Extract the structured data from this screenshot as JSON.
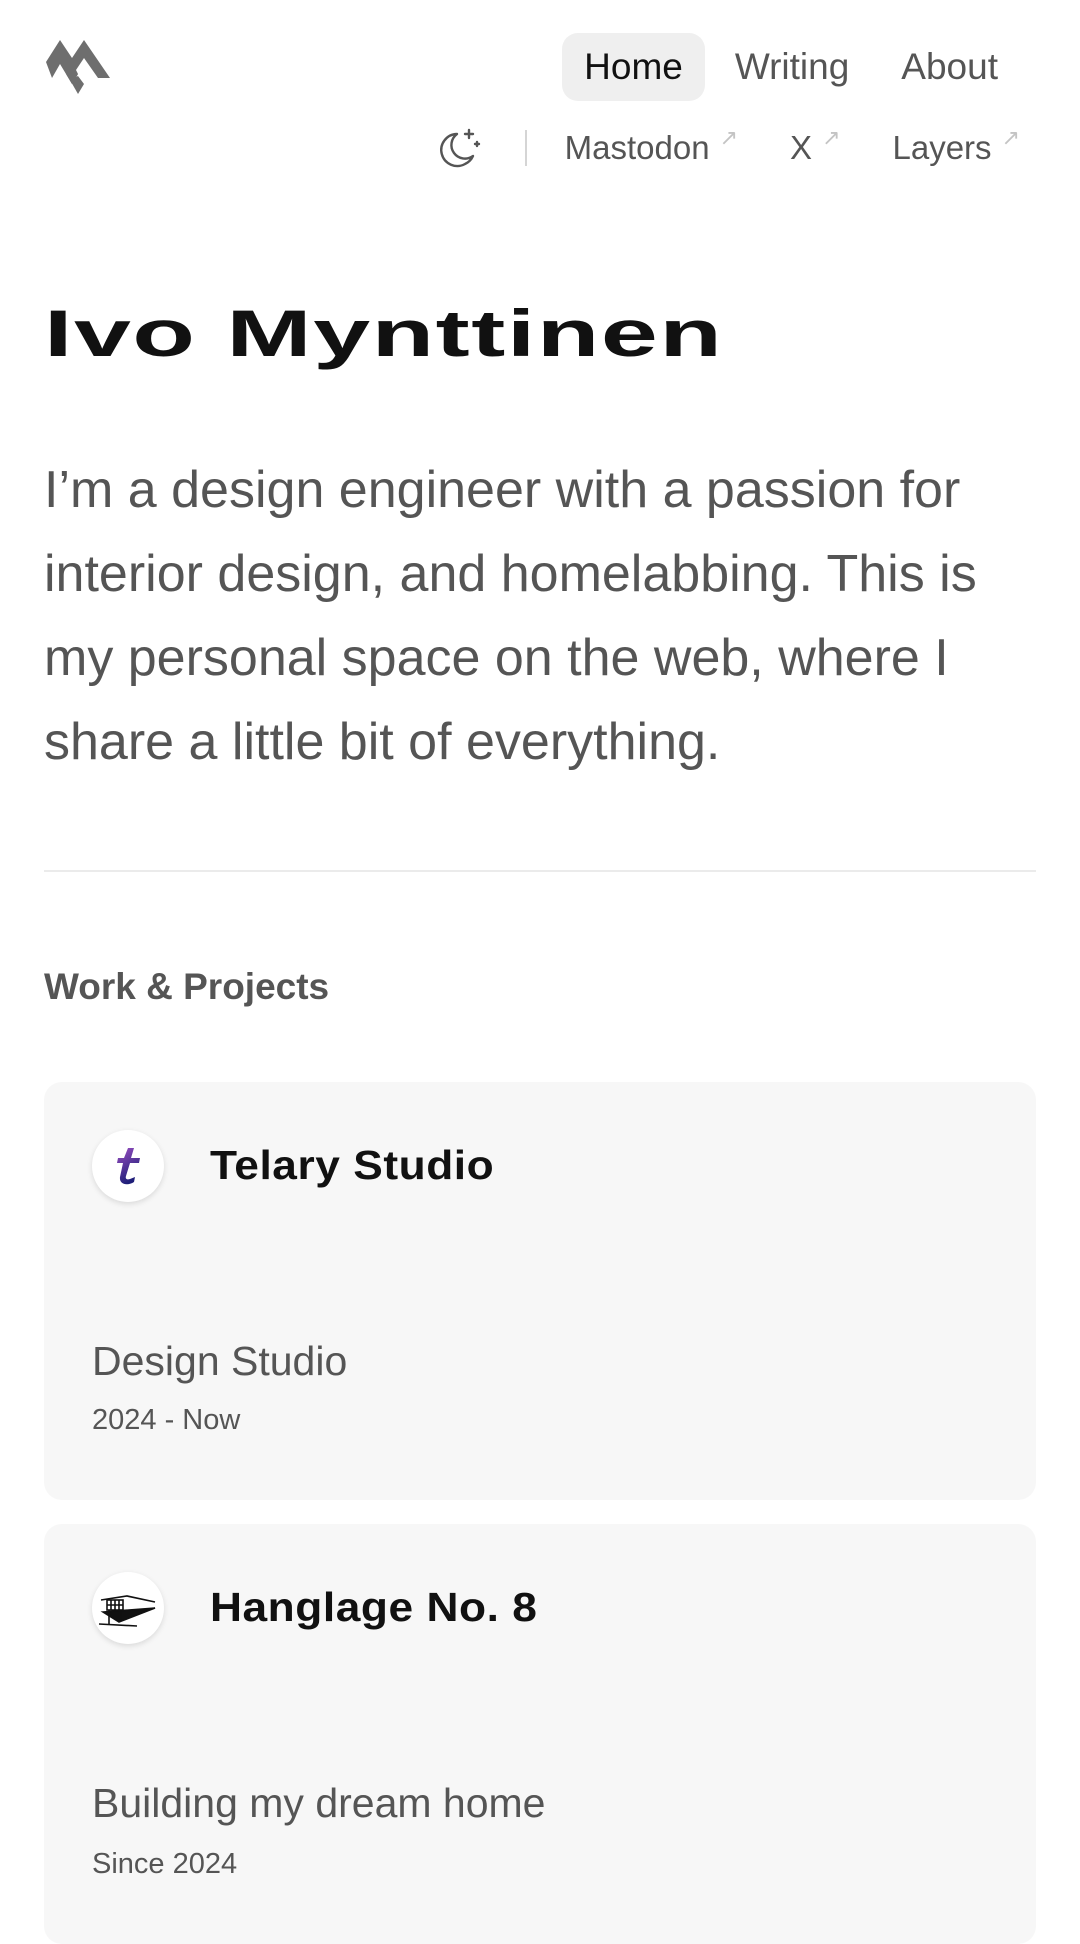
{
  "header": {
    "logo_icon": "m-logo-icon",
    "nav": [
      {
        "label": "Home",
        "active": true
      },
      {
        "label": "Writing",
        "active": false
      },
      {
        "label": "About",
        "active": false
      }
    ],
    "theme_toggle_icon": "moon-sparkle-icon",
    "social": [
      {
        "label": "Mastodon",
        "icon": "external-arrow-icon"
      },
      {
        "label": "X",
        "icon": "external-arrow-icon"
      },
      {
        "label": "Layers",
        "icon": "external-arrow-icon"
      }
    ]
  },
  "hero": {
    "name": "Ivo Mynttinen",
    "intro": "I’m a design engineer with a passion for interior design, and homelabbing. This is my personal space on the web, where I share a little bit of everything."
  },
  "work": {
    "title": "Work & Projects",
    "items": [
      {
        "title": "Telary Studio",
        "description": "Design Studio",
        "date": "2024 - Now",
        "logo_letter": "t",
        "logo_icon": "telary-logo-icon"
      },
      {
        "title": "Hanglage No. 8",
        "description": "Building my dream home",
        "date": "Since 2024",
        "logo_icon": "house-sketch-icon"
      }
    ]
  },
  "colors": {
    "text_primary": "#111111",
    "text_secondary": "#555555",
    "card_bg": "#f7f7f7",
    "nav_active_bg": "#efefef",
    "telary_gradient": [
      "#8a3fb0",
      "#1f1f7a"
    ]
  }
}
